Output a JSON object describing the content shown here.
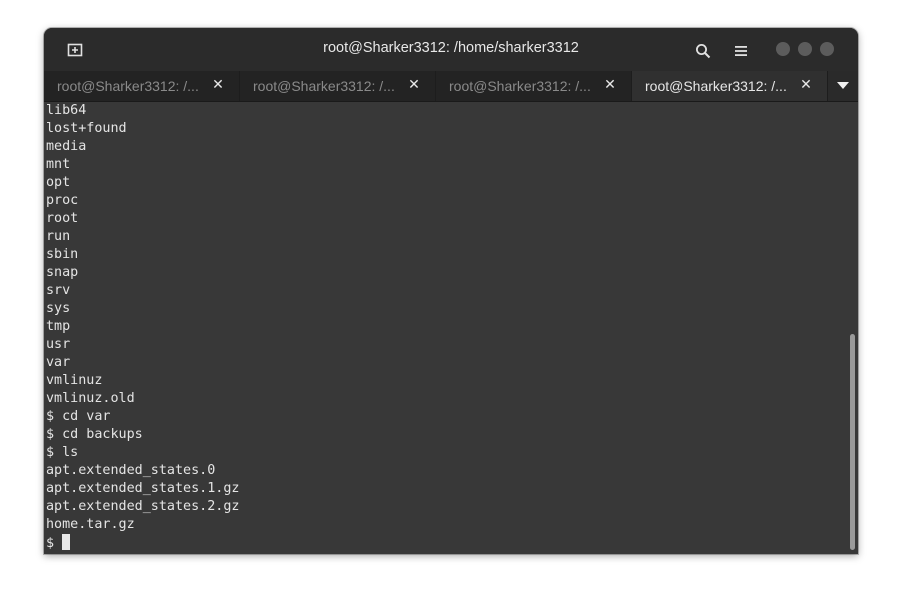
{
  "window": {
    "title": "root@Sharker3312: /home/sharker3312"
  },
  "icons": {
    "new_tab": "new-tab-icon",
    "search": "search-icon",
    "menu": "hamburger-menu-icon",
    "tab_close": "close-icon",
    "tab_overflow": "chevron-down-icon"
  },
  "tabs": [
    {
      "label": "root@Sharker3312: /...",
      "close": "✕",
      "active": false
    },
    {
      "label": "root@Sharker3312: /...",
      "close": "✕",
      "active": false
    },
    {
      "label": "root@Sharker3312: /...",
      "close": "✕",
      "active": false
    },
    {
      "label": "root@Sharker3312: /...",
      "close": "✕",
      "active": true
    }
  ],
  "terminal": {
    "lines": [
      "lib64",
      "lost+found",
      "media",
      "mnt",
      "opt",
      "proc",
      "root",
      "run",
      "sbin",
      "snap",
      "srv",
      "sys",
      "tmp",
      "usr",
      "var",
      "vmlinuz",
      "vmlinuz.old",
      "$ cd var",
      "$ cd backups",
      "$ ls",
      "apt.extended_states.0",
      "apt.extended_states.1.gz",
      "apt.extended_states.2.gz",
      "home.tar.gz"
    ],
    "prompt": "$ "
  },
  "colors": {
    "terminal_bg": "#383838",
    "titlebar_bg": "#2b2b2b",
    "text": "#e4e4e4"
  }
}
